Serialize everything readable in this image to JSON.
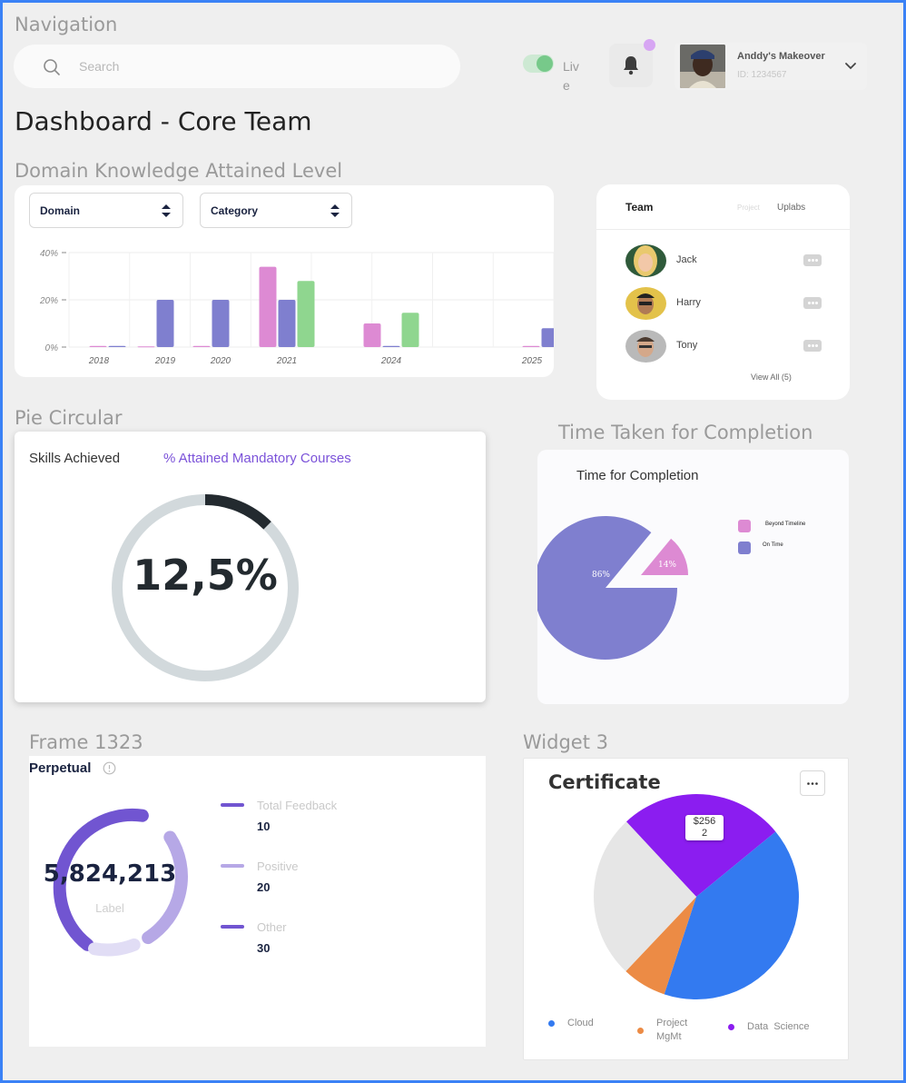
{
  "nav": {
    "section_title": "Navigation",
    "search_placeholder": "Search",
    "live_label": "Live",
    "profile": {
      "name": "Anddy's Makeover",
      "id": "ID: 1234567"
    }
  },
  "page_title": "Dashboard - Core Team",
  "domain": {
    "section_title": "Domain Knowledge Attained Level",
    "filters": {
      "domain": "Domain",
      "category": "Category"
    }
  },
  "team": {
    "tabs": {
      "team": "Team",
      "project": "Project",
      "uplabs": "Uplabs"
    },
    "members": [
      "Jack",
      "Harry",
      "Tony"
    ],
    "view_all": "View All (5)"
  },
  "pie_circular": {
    "section_title": "Pie Circular",
    "tab_skills": "Skills Achieved",
    "tab_courses": "% Attained Mandatory Courses",
    "value_text": "12,5%",
    "value_fraction": 0.125
  },
  "time": {
    "section_title": "Time Taken for Completion",
    "chart_title": "Time for Completion",
    "legend_beyond": "Beyond Timeline",
    "legend_on_time": "On Time",
    "label_on_time": "86%",
    "label_beyond": "14%"
  },
  "perpetual": {
    "section_title": "Frame 1323",
    "title": "Perpetual",
    "value": "5,824,213",
    "label": "Label",
    "legend": [
      {
        "label": "Total Feedback",
        "value": "10"
      },
      {
        "label": "Positive",
        "value": "20"
      },
      {
        "label": "Other",
        "value": "30"
      }
    ]
  },
  "certificate": {
    "section_title": "Widget 3",
    "title": "Certificate",
    "tooltip_line1": "$256",
    "tooltip_line2": "2",
    "legend": {
      "cloud": "Cloud",
      "project_line1": "Project",
      "project_line2": "MgMt",
      "data_science": "Data  Science"
    }
  },
  "colors": {
    "pink": "#dd8ad3",
    "indigo": "#7f7fcf",
    "green": "#8fd68f",
    "purple": "#8b1df0",
    "blue": "#337af0",
    "orange": "#ec8b45",
    "light_gray": "#e6e6e6",
    "accent_text": "#7b52d9"
  },
  "chart_data": [
    {
      "type": "bar",
      "categories": [
        "2018",
        "2019",
        "2020",
        "2021",
        "2024",
        "2025"
      ],
      "ylim": [
        0,
        40
      ],
      "yticks": [
        "0%",
        "20%",
        "40%"
      ],
      "series": [
        {
          "values": [
            0.5,
            0.3,
            0.5,
            34,
            10,
            0.5
          ]
        },
        {
          "values": [
            0.5,
            20,
            20,
            20,
            0.5,
            8
          ]
        },
        {
          "values": [
            0,
            0,
            0,
            28,
            14.5,
            0
          ]
        }
      ]
    },
    {
      "type": "pie",
      "title": "Time for Completion",
      "labels": [
        "On Time",
        "Beyond Timeline"
      ],
      "values": [
        86,
        14
      ]
    },
    {
      "type": "pie",
      "title": "Certificate",
      "labels": [
        "Data  Science",
        "Cloud",
        "Project MgMt",
        ""
      ],
      "values": [
        26,
        41,
        7,
        26
      ]
    }
  ]
}
